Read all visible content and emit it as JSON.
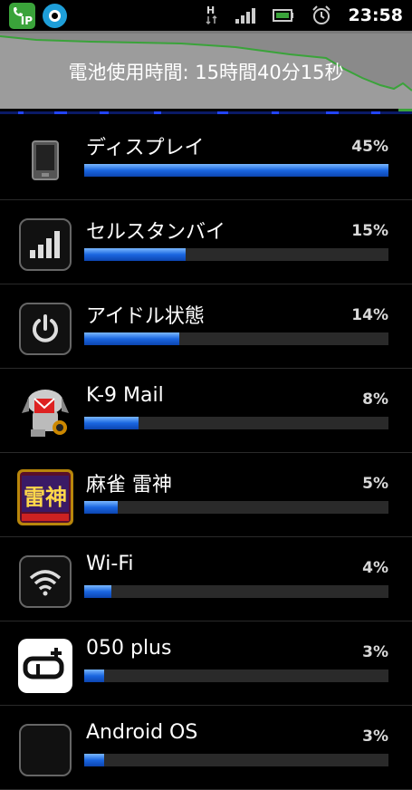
{
  "status_bar": {
    "time": "23:58",
    "network_type": "H",
    "left_icons": [
      "ip-phone-app-icon",
      "target-app-icon"
    ],
    "right_icons": [
      "data-arrows-icon",
      "signal-icon",
      "battery-icon",
      "alarm-icon"
    ]
  },
  "graph": {
    "label": "電池使用時間: 15時間40分15秒",
    "fill_color": "#8a8a8a",
    "line_color": "#3aa33a"
  },
  "items": [
    {
      "name": "ディスプレイ",
      "percent": "45%",
      "fraction": 0.45,
      "icon": "display-icon"
    },
    {
      "name": "セルスタンバイ",
      "percent": "15%",
      "fraction": 0.15,
      "icon": "signal-bars-icon"
    },
    {
      "name": "アイドル状態",
      "percent": "14%",
      "fraction": 0.14,
      "icon": "power-icon"
    },
    {
      "name": "K-9 Mail",
      "percent": "8%",
      "fraction": 0.08,
      "icon": "k9-mail-icon"
    },
    {
      "name": "麻雀 雷神",
      "percent": "5%",
      "fraction": 0.05,
      "icon": "mahjong-raijin-icon"
    },
    {
      "name": "Wi-Fi",
      "percent": "4%",
      "fraction": 0.04,
      "icon": "wifi-icon"
    },
    {
      "name": "050 plus",
      "percent": "3%",
      "fraction": 0.03,
      "icon": "050plus-icon"
    },
    {
      "name": "Android OS",
      "percent": "3%",
      "fraction": 0.03,
      "icon": "android-os-icon"
    }
  ],
  "colors": {
    "bar_fill": "#1a66e0",
    "bar_track": "#2a2a2a",
    "background": "#000000"
  }
}
